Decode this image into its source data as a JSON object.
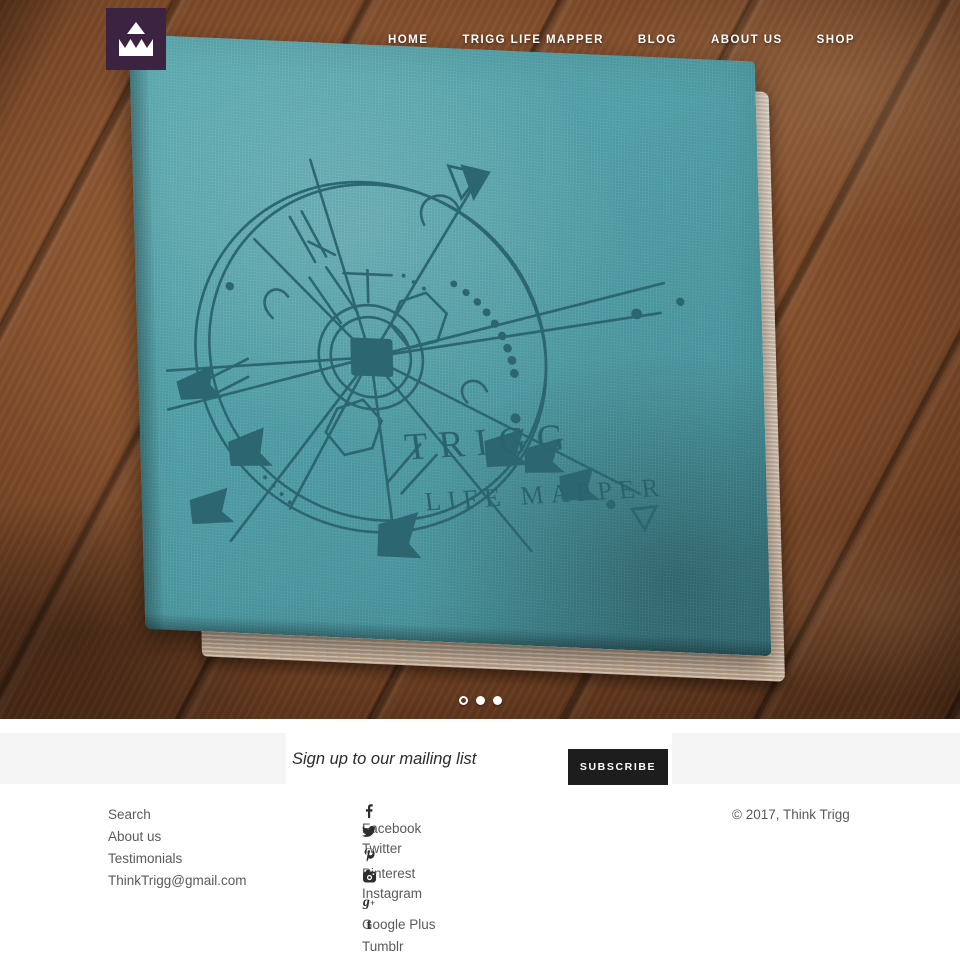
{
  "header": {
    "logo": {
      "name": "trigg-logo",
      "alt": "Think Trigg crown logo"
    },
    "nav": [
      {
        "label": "HOME",
        "name": "nav-home"
      },
      {
        "label": "TRIGG LIFE MAPPER",
        "name": "nav-trigg-life-mapper"
      },
      {
        "label": "BLOG",
        "name": "nav-blog"
      },
      {
        "label": "ABOUT US",
        "name": "nav-about-us"
      },
      {
        "label": "SHOP",
        "name": "nav-shop"
      }
    ]
  },
  "hero": {
    "alt": "Teal hardcover notebook on a wooden table",
    "book_title": "TRIGG",
    "book_subtitle": "LIFE MAPPER",
    "colors": {
      "cover_teal": "#54a4ac",
      "cover_ink": "#2c6670",
      "wood_brown": "#8a5430",
      "pages_cream": "#e0ccb6"
    },
    "carousel": {
      "slides": 3,
      "active": 1,
      "dots": [
        "slide-1",
        "slide-2",
        "slide-3"
      ]
    }
  },
  "newsletter": {
    "placeholder": "Sign up to our mailing list",
    "value": "",
    "subscribe_label": "SUBSCRIBE",
    "button_color": "#1d1d1d",
    "band_color": "#f5f5f5"
  },
  "footer": {
    "links": [
      {
        "label": "Search",
        "name": "footer-link-search"
      },
      {
        "label": "About us",
        "name": "footer-link-about-us"
      },
      {
        "label": "Testimonials",
        "name": "footer-link-testimonials"
      },
      {
        "label": "ThinkTrigg@gmail.com",
        "name": "footer-link-email"
      }
    ],
    "social": [
      {
        "label": "Facebook",
        "icon": "facebook-icon",
        "glyph": "f"
      },
      {
        "label": "Twitter",
        "icon": "twitter-icon",
        "glyph": "✒"
      },
      {
        "label": "Pinterest",
        "icon": "pinterest-icon",
        "glyph": "P"
      },
      {
        "label": "Instagram",
        "icon": "instagram-icon",
        "glyph": "▣"
      },
      {
        "label": "Google Plus",
        "icon": "google-plus-icon",
        "glyph": "g"
      },
      {
        "label": "Tumblr",
        "icon": "tumblr-icon",
        "glyph": "t"
      }
    ],
    "copyright": "© 2017, Think Trigg"
  }
}
